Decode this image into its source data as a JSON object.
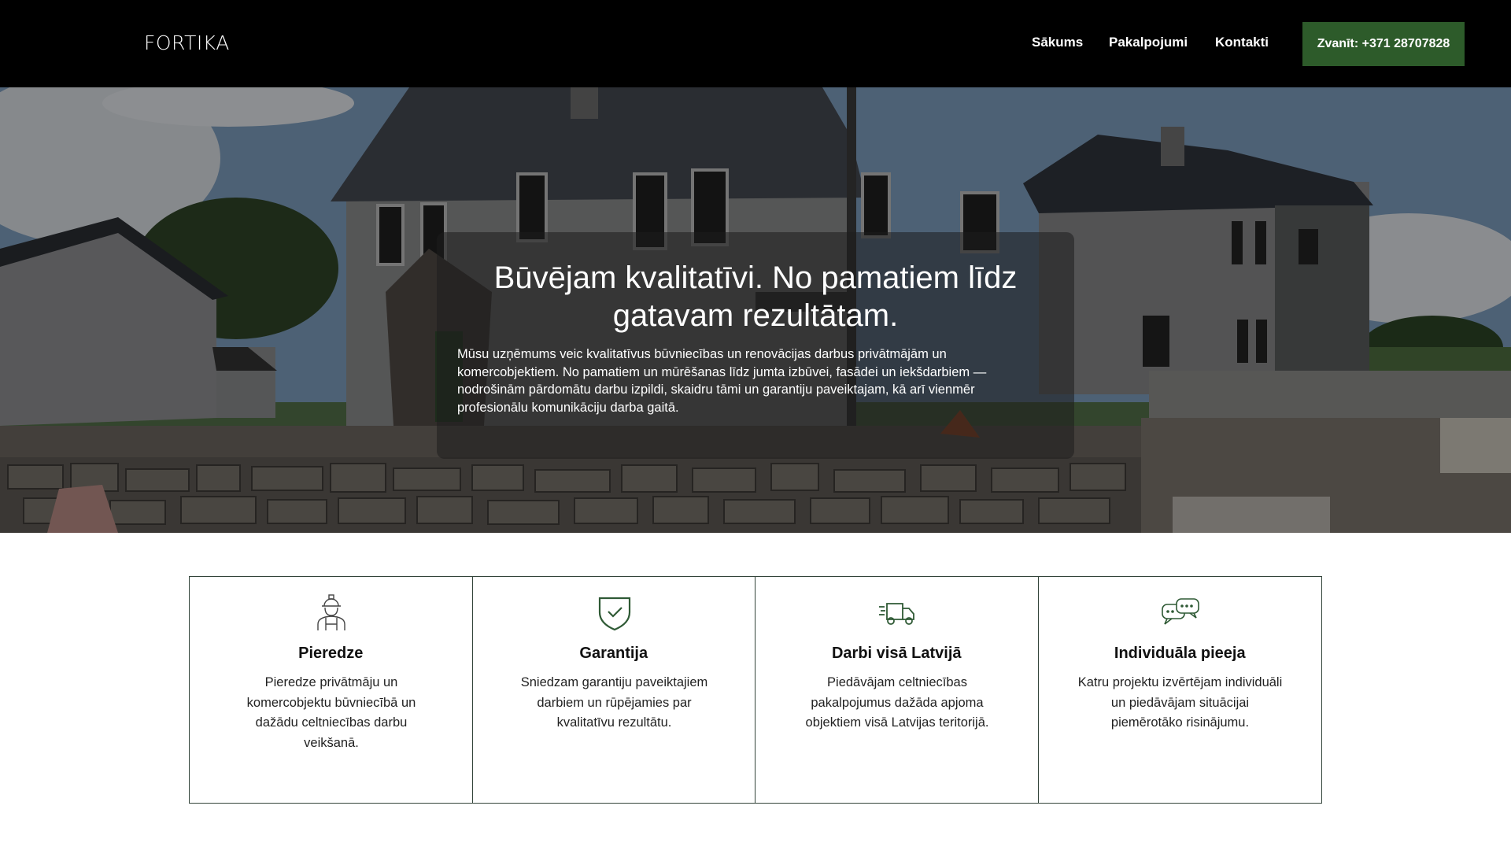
{
  "header": {
    "logo": "FORTIKA",
    "nav": [
      {
        "label": "Sākums"
      },
      {
        "label": "Pakalpojumi"
      },
      {
        "label": "Kontakti"
      }
    ],
    "call_button": "Zvanīt: +371 28707828"
  },
  "hero": {
    "title": "Būvējam kvalitatīvi. No pamatiem līdz gatavam rezultātam.",
    "text": "Mūsu uzņēmums veic kvalitatīvus būvniecības un renovācijas darbus privātmājām un komercobjektiem. No pamatiem un mūrēšanas līdz jumta izbūvei, fasādei un iekšdarbiem — nodrošinām pārdomātu darbu izpildi, skaidru tāmi un garantiju paveiktajam, kā arī vienmēr profesionālu komunikāciju darba gaitā."
  },
  "features": [
    {
      "icon": "worker-icon",
      "title": "Pieredze",
      "text": "Pieredze privātmāju un komercobjektu būvniecībā un dažādu celtniecības darbu veikšanā."
    },
    {
      "icon": "shield-check-icon",
      "title": "Garantija",
      "text": "Sniedzam garantiju paveiktajiem darbiem un rūpējamies par kvalitatīvu rezultātu."
    },
    {
      "icon": "truck-icon",
      "title": "Darbi visā Latvijā",
      "text": "Piedāvājam celtniecības pakalpojumus dažāda apjoma objektiem visā Latvijas teritorijā."
    },
    {
      "icon": "chat-icon",
      "title": "Individuāla pieeja",
      "text": "Katru projektu izvērtējam individuāli un piedāvājam situācijai piemērotāko risinājumu."
    }
  ],
  "colors": {
    "header_bg": "#000000",
    "accent_green": "#2d5b2a",
    "icon_green": "#2f5a35",
    "border": "#33443a"
  }
}
